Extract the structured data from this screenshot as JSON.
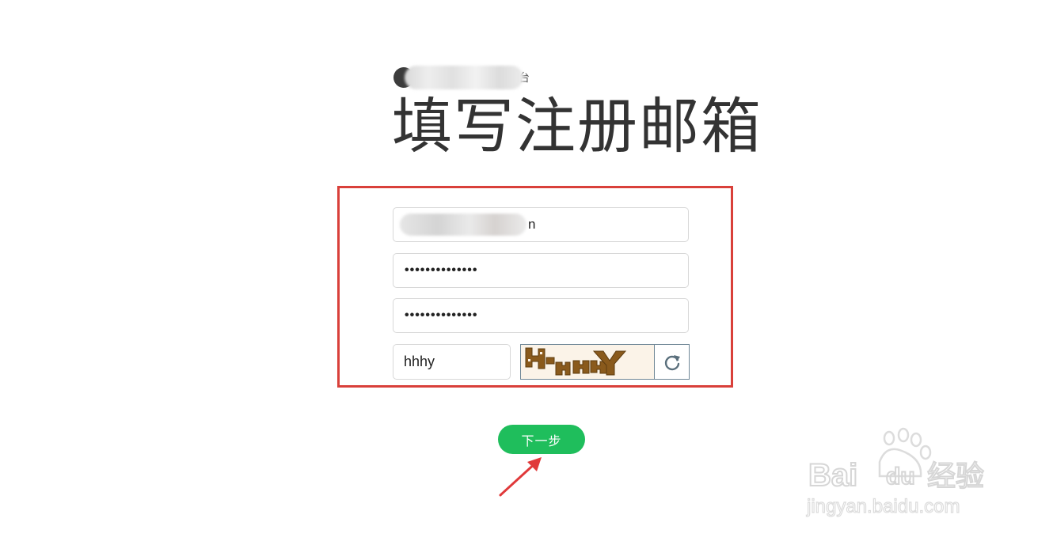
{
  "header": {
    "brand_tail": "台",
    "title": "填写注册邮箱"
  },
  "form": {
    "email_value_tail": "n",
    "password_dots": "••••••••••••••",
    "confirm_password_dots": "••••••••••••••",
    "captcha_value": "hhhy",
    "captcha_image_text": "HHHY"
  },
  "actions": {
    "next_label": "下一步"
  },
  "colors": {
    "highlight_border": "#d9403a",
    "button_green": "#1fbe5c",
    "captcha_brown": "#8a5a1c",
    "watermark_gray": "#dcdcdc"
  },
  "watermark": {
    "brand_text": "Bai",
    "brand_du": "du",
    "brand_cn": "经验",
    "url": "jingyan.baidu.com"
  }
}
